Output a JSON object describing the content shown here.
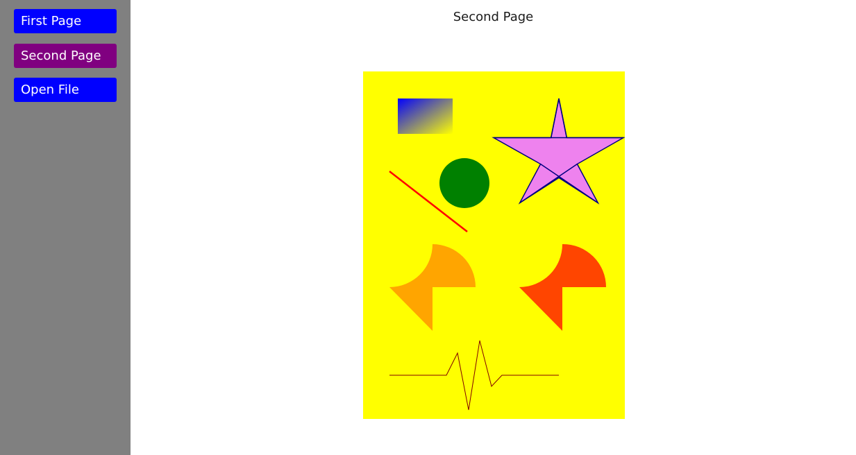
{
  "sidebar": {
    "buttons": [
      {
        "label": "First Page",
        "state": "default",
        "color": "#0000ff"
      },
      {
        "label": "Second Page",
        "state": "selected",
        "color": "#800080"
      },
      {
        "label": "Open File",
        "state": "default",
        "color": "#0000ff"
      }
    ]
  },
  "main": {
    "title": "Second Page"
  },
  "colors": {
    "sidebar_bg": "#808080",
    "canvas_bg": "#ffff00",
    "gradient_start": "#0000ff",
    "gradient_end": "#ffff00",
    "star_fill": "#ee82ee",
    "star_stroke": "#000080",
    "circle_fill": "#008000",
    "line_stroke": "#ff0000",
    "shape_left_fill": "#ffa500",
    "shape_right_fill": "#ff4500",
    "pulse_stroke": "#800000"
  },
  "canvas": {
    "shapes": [
      "gradient-rectangle",
      "star",
      "circle",
      "line",
      "orange-curved-shape",
      "orangered-curved-shape",
      "pulse-polyline"
    ]
  }
}
